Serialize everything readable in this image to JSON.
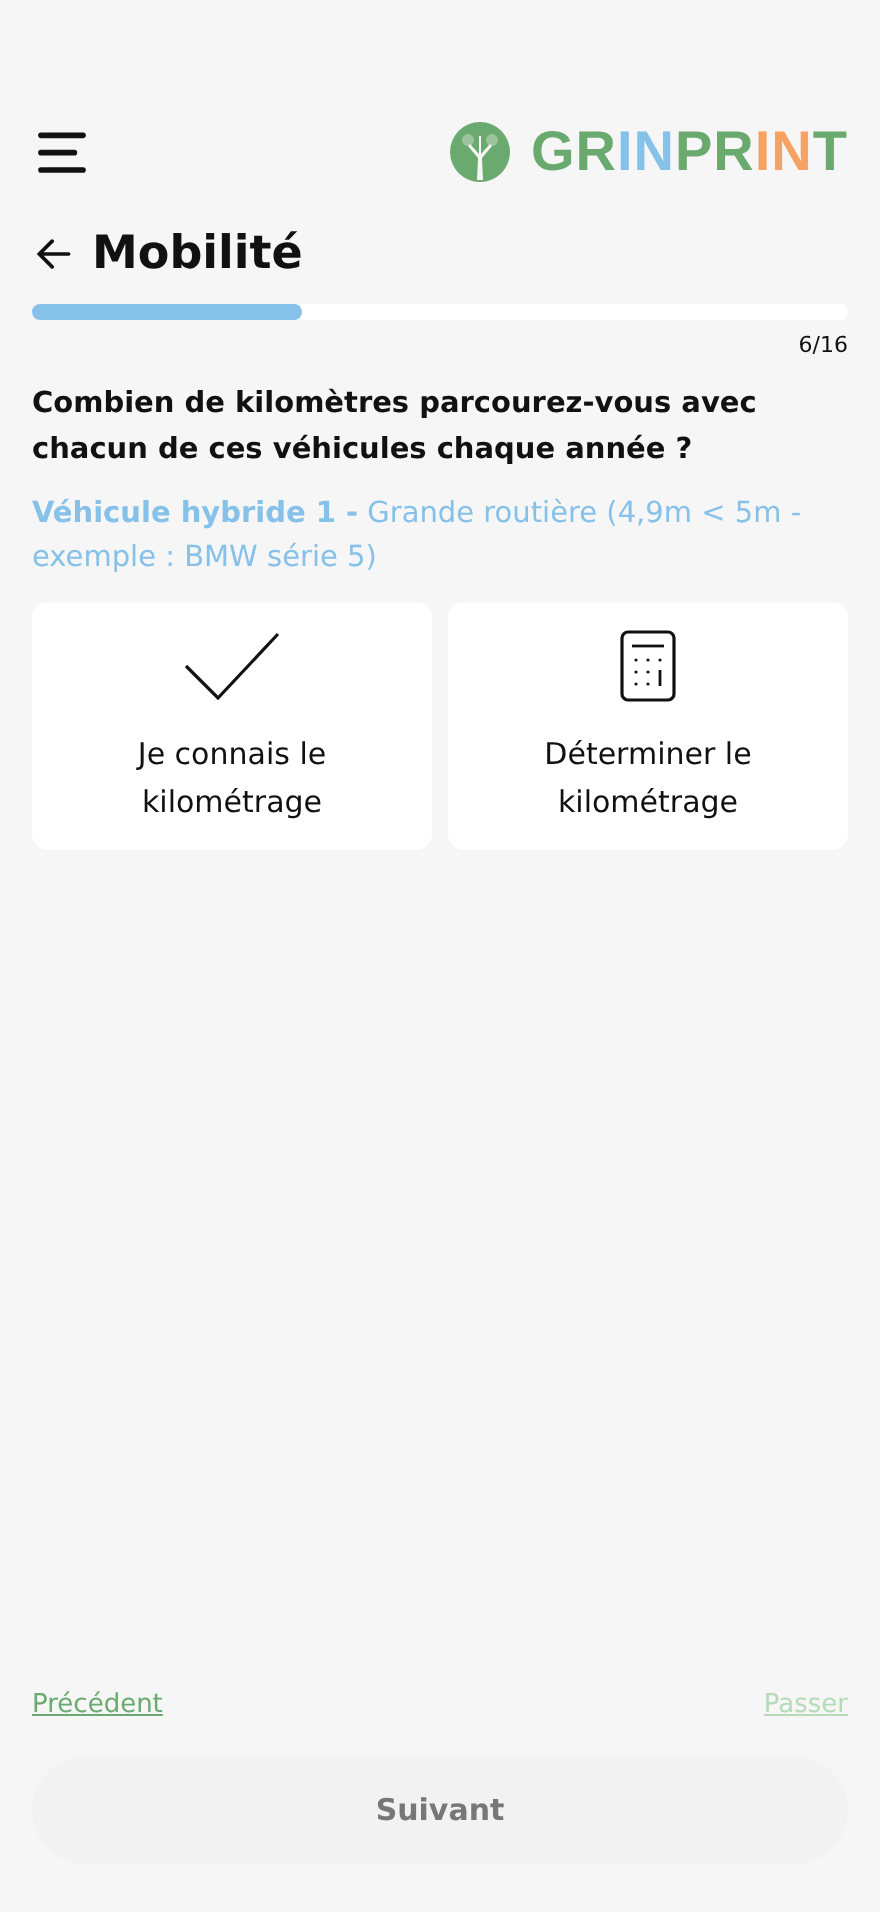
{
  "header": {
    "logo": [
      {
        "text": "GR",
        "color": "#6aaa6e"
      },
      {
        "text": "IN",
        "color": "#85c1e9"
      },
      {
        "text": "PR",
        "color": "#6aaa6e"
      },
      {
        "text": "IN",
        "color": "#f5a263"
      },
      {
        "text": "T",
        "color": "#6aaa6e"
      }
    ]
  },
  "title": "Mobilité",
  "progress": {
    "level": 0.33,
    "count": "6/16"
  },
  "question": "Combien de kilomètres parcourez-vous avec chacun de ces véhicules chaque année ?",
  "vehicle": "**Véhicule hybride 1 -** Grande routière (4,9m < 5m - exemple : BMW série 5)",
  "options": [
    {
      "kind": "check",
      "label": "Je connais le kilométrage"
    },
    {
      "kind": "calculator",
      "label": "Déterminer le kilométrage"
    }
  ],
  "footer": {
    "previous": {
      "label": "Précédent",
      "disabled": false
    },
    "skip": {
      "label": "Passer",
      "disabled": true
    },
    "next": {
      "label": "Suivant",
      "disabled": true
    }
  }
}
